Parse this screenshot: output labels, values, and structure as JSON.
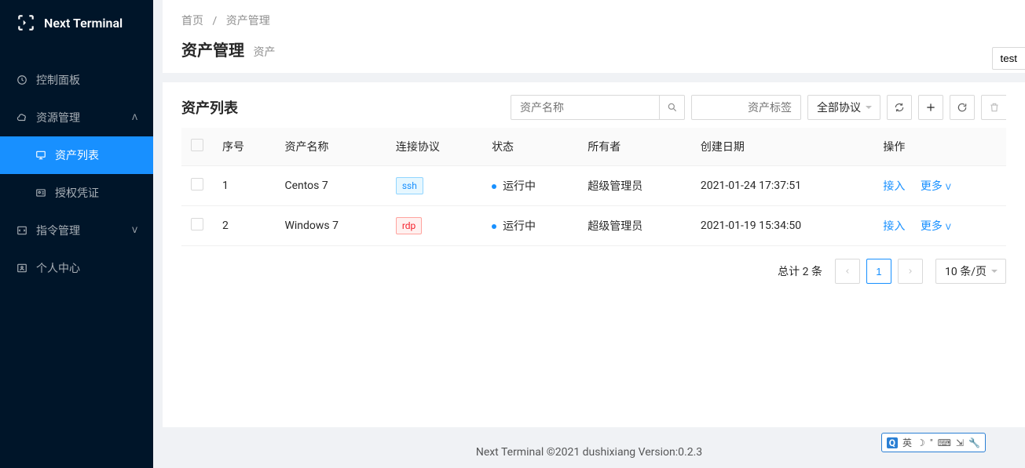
{
  "app": {
    "name": "Next Terminal"
  },
  "sidebar": {
    "items": [
      {
        "label": "控制面板",
        "icon": "dashboard"
      },
      {
        "label": "资源管理",
        "icon": "cloud",
        "expanded": true,
        "children": [
          {
            "label": "资产列表",
            "icon": "desktop",
            "selected": true
          },
          {
            "label": "授权凭证",
            "icon": "idcard"
          }
        ]
      },
      {
        "label": "指令管理",
        "icon": "code",
        "expanded": false
      },
      {
        "label": "个人中心",
        "icon": "user"
      }
    ]
  },
  "breadcrumb": {
    "home": "首页",
    "current": "资产管理"
  },
  "page": {
    "title": "资产管理",
    "subtitle": "资产"
  },
  "topButton": "test",
  "list": {
    "title": "资产列表",
    "search": {
      "name_placeholder": "资产名称",
      "tags_placeholder": "资产标签",
      "protocol": "全部协议"
    },
    "columns": {
      "index": "序号",
      "name": "资产名称",
      "protocol": "连接协议",
      "status": "状态",
      "owner": "所有者",
      "created": "创建日期",
      "actions": "操作"
    },
    "rows": [
      {
        "index": "1",
        "name": "Centos 7",
        "protocol": "ssh",
        "protocolColor": "blue",
        "status": "运行中",
        "owner": "超级管理员",
        "created": "2021-01-24 17:37:51"
      },
      {
        "index": "2",
        "name": "Windows 7",
        "protocol": "rdp",
        "protocolColor": "red",
        "status": "运行中",
        "owner": "超级管理员",
        "created": "2021-01-19 15:34:50"
      }
    ],
    "actions": {
      "access": "接入",
      "more": "更多"
    }
  },
  "pagination": {
    "total": "总计 2 条",
    "current": "1",
    "pageSize": "10 条/页"
  },
  "footer": "Next Terminal ©2021 dushixiang Version:0.2.3",
  "ime": {
    "q": "Q",
    "lang": "英"
  }
}
